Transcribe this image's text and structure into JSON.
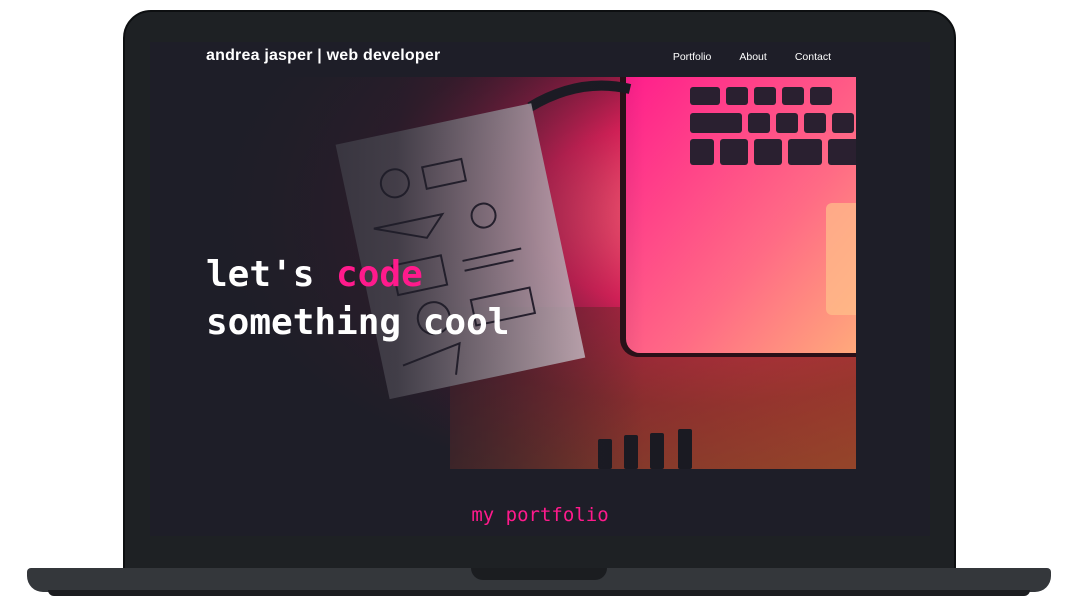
{
  "header": {
    "title": "andrea jasper | web developer"
  },
  "nav": {
    "items": [
      {
        "label": "Portfolio"
      },
      {
        "label": "About"
      },
      {
        "label": "Contact"
      }
    ]
  },
  "hero": {
    "line1_prefix": "let's ",
    "line1_accent": "code",
    "line2": "something cool"
  },
  "section": {
    "portfolio_heading": "my portfolio"
  },
  "colors": {
    "accent": "#ff1a8c",
    "background": "#1e1e28",
    "bezel": "#1e2124"
  }
}
